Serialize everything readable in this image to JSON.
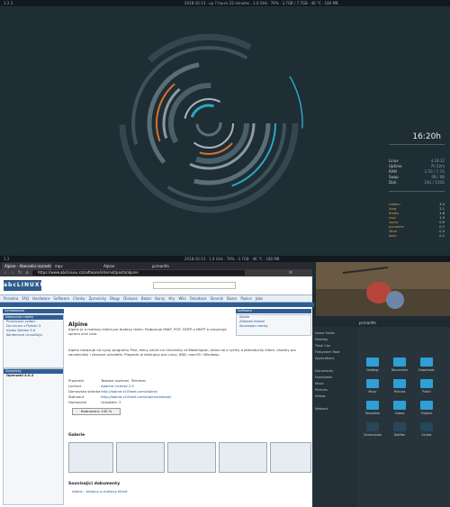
{
  "top_bar": {
    "text": "2018-10-13 · up 7 hours 22 minutes · 1.0 GHz · 79% · 3.7GB / 7.7GB · 46 °C · 180 MB"
  },
  "mid_bar": {
    "text": "2018-10-13 · 1.0 GHz · 79% · 3.7GB · 46 °C · 180 MB"
  },
  "clock": {
    "time": "16:20h"
  },
  "system": [
    {
      "label": "Linux",
      "value": "4.18.12"
    },
    {
      "label": "Uptime",
      "value": "7h 22m"
    },
    {
      "label": "RAM",
      "value": "3.7G / 7.7G"
    },
    {
      "label": "Swap",
      "value": "0B / 0B"
    },
    {
      "label": "Disk",
      "value": "33G / 110G"
    }
  ],
  "processes": [
    {
      "name": "radeon",
      "value": "3.4"
    },
    {
      "name": "Xorg",
      "value": "2.1"
    },
    {
      "name": "firefox",
      "value": "1.8"
    },
    {
      "name": "mpv",
      "value": "1.5"
    },
    {
      "name": "conky",
      "value": "0.9"
    },
    {
      "name": "pcmanfm",
      "value": "0.7"
    },
    {
      "name": "i3bar",
      "value": "0.3"
    },
    {
      "name": "bash",
      "value": "0.1"
    }
  ],
  "browser": {
    "tabs": [
      "Alpine - Abecedni rozcestnik",
      "mpv",
      "Alpine",
      "pcmanfm"
    ],
    "url": "https://www.abclinuxu.cz/software/internet/posta/alpine",
    "logo": "abcLINUXU",
    "menu": [
      "Poradna",
      "FAQ",
      "Hardware",
      "Software",
      "Clanky",
      "Zpravicky",
      "Blogy",
      "Diskuse",
      "Bazar",
      "Kurzy",
      "Hry",
      "Wiki",
      "Ovladace",
      "Slovnik",
      "Bazar",
      "Pozice",
      "Jobs"
    ],
    "left_header": "Vyhledavani",
    "left_box_title": "Nejnovejsi clanky",
    "left_links": [
      "Prosincove vydani",
      "Do Linuxu s Python 3",
      "Vydan Debian 9.6",
      "Konference LinuxDays"
    ],
    "left_box2_title": "Zpravicky",
    "left_box2_text": "Openwall 4.0.2",
    "right_header": "Software",
    "right_links": [
      "Alpine",
      "Zobrazit historii",
      "Souvisejici clanky"
    ],
    "app_title": "Alpine",
    "description": "Alpine je e-mailovy klient pro textovy rezim. Podporuje IMAP, POP, SMTP a NNTP a umoznuje spravu vice uctu.",
    "description2": "Alpine navazuje na vyvoj programu Pine, ktery vznikl na University of Washington. Jedna se o rychly a jednoduchy klient, vhodny pro zacatecniky i zkusene uzivatele. Program je dostupny pro Linux, BSD, macOS i Windows.",
    "fields": [
      {
        "label": "Prostredi",
        "value": "Textove rozhrani, Terminal"
      },
      {
        "label": "Licence",
        "value": "Apache License 2.0"
      },
      {
        "label": "Domovska stranka",
        "value": "http://alpine.x10host.com/alpine/"
      },
      {
        "label": "Stahnout",
        "value": "http://alpine.x10host.com/alpine/release/"
      },
      {
        "label": "Hodnoceni",
        "value": "Uzivatele: 2"
      }
    ],
    "rating_label": "Hodnoceni: 100 %",
    "gallery_title": "Galerie",
    "related_title": "Souvisejici dokumenty",
    "related_link": "Alpine - textovy e-mailovy klient"
  },
  "filemanager": {
    "title": "pcmanfm",
    "sidebar": [
      "Home Folder",
      "Desktop",
      "Trash Can",
      "Filesystem Root",
      "Applications",
      "Documents",
      "Downloads",
      "Music",
      "Pictures",
      "Videos",
      "Network"
    ],
    "folders": [
      "Desktop",
      "Documents",
      "Downloads",
      "Music",
      "Pictures",
      "Public",
      "Templates",
      "Videos",
      "Projects",
      "Screenshots",
      "Dotfiles",
      "Scripts"
    ]
  },
  "colors": {
    "accent_cyan": "#2aa8c7",
    "accent_orange": "#d9722c",
    "ring": "#3a4e58"
  }
}
